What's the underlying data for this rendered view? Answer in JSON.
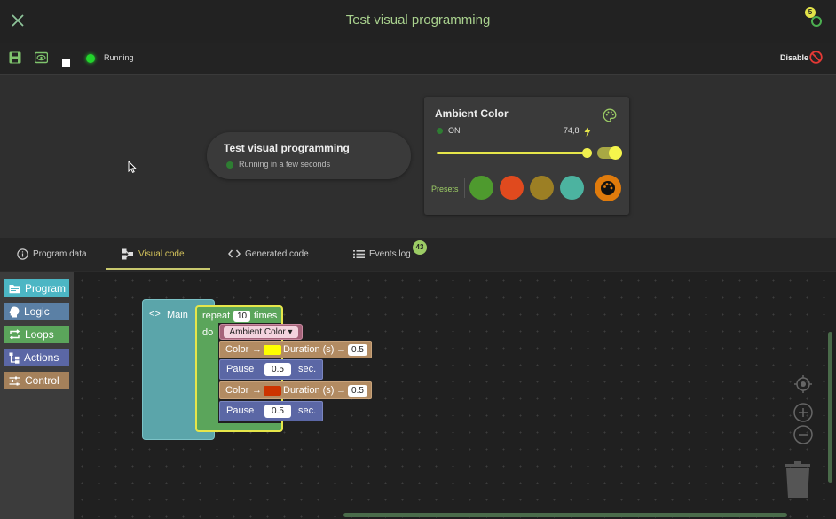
{
  "header": {
    "title": "Test visual programming",
    "notification_count": "5"
  },
  "toolbar": {
    "status": "Running",
    "disable_label": "Disable"
  },
  "program_card": {
    "name": "Test visual programming",
    "subtitle": "Running in a few seconds"
  },
  "device_card": {
    "name": "Ambient Color",
    "state": "ON",
    "power": "74,8",
    "presets_label": "Presets",
    "presets": [
      "#4e9a2e",
      "#e04a1e",
      "#9c7f24",
      "#4cb3a0"
    ],
    "brightness_fraction": 0.99
  },
  "tabs": [
    {
      "label": "Program data",
      "icon": "info-icon"
    },
    {
      "label": "Visual code",
      "icon": "blocks-icon"
    },
    {
      "label": "Generated code",
      "icon": "code-icon"
    },
    {
      "label": "Events log",
      "icon": "list-icon"
    }
  ],
  "events_count": "43",
  "toolbox": [
    {
      "label": "Program",
      "color": "#4cb6c4"
    },
    {
      "label": "Logic",
      "color": "#5b80a5"
    },
    {
      "label": "Loops",
      "color": "#5ba55b"
    },
    {
      "label": "Actions",
      "color": "#5b67a5"
    },
    {
      "label": "Control",
      "color": "#a5815b"
    }
  ],
  "blocks": {
    "main_label": "Main",
    "repeat_label": "repeat",
    "repeat_times": "10",
    "times_label": "times",
    "do_label": "do",
    "device": "Ambient Color ▾",
    "color_label": "Color",
    "arrow": "→",
    "duration_label": "Duration (s)",
    "duration1": "0.5",
    "color1": "#ffff00",
    "pause_label": "Pause",
    "pause1": "0.5",
    "sec_label": "sec.",
    "duration2": "0.5",
    "color2": "#cc3300",
    "pause2": "0.5"
  }
}
